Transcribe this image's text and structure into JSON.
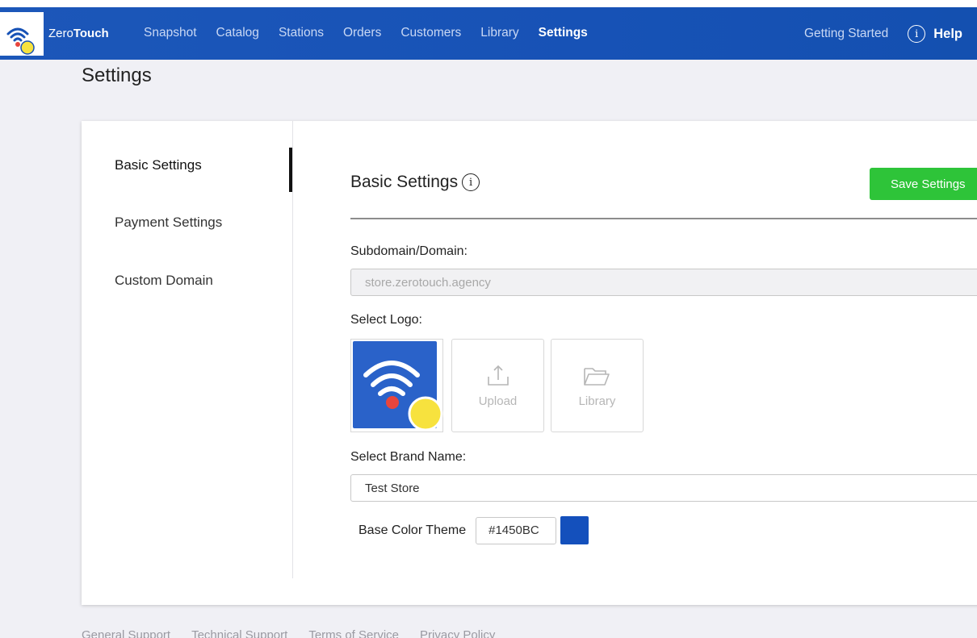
{
  "app": {
    "brand_prefix": "Zero",
    "brand_suffix": "Touch"
  },
  "nav": {
    "items": [
      {
        "label": "Snapshot"
      },
      {
        "label": "Catalog"
      },
      {
        "label": "Stations"
      },
      {
        "label": "Orders"
      },
      {
        "label": "Customers"
      },
      {
        "label": "Library"
      },
      {
        "label": "Settings",
        "active": true
      }
    ],
    "getting_started": "Getting Started",
    "help": "Help"
  },
  "page": {
    "title": "Settings"
  },
  "sidebar": {
    "items": [
      {
        "label": "Basic Settings",
        "active": true
      },
      {
        "label": "Payment Settings"
      },
      {
        "label": "Custom Domain"
      }
    ]
  },
  "basic": {
    "title": "Basic Settings",
    "save_label": "Save Settings",
    "domain_label": "Subdomain/Domain:",
    "domain_value": "store.zerotouch.agency",
    "logo_label": "Select Logo:",
    "upload_label": "Upload",
    "library_label": "Library",
    "brand_label": "Select Brand Name:",
    "brand_value": "Test Store",
    "color_label": "Base Color Theme",
    "color_hex": "#1450BC"
  },
  "colors": {
    "nav_bg": "#1752b6",
    "save_button": "#2ec439",
    "theme_swatch": "#1450bc",
    "logo_bg": "#2a62c9",
    "logo_dot_red": "#e8453c",
    "logo_dot_yellow": "#f7e23e"
  },
  "footer": {
    "links": [
      {
        "label": "General Support"
      },
      {
        "label": "Technical Support"
      },
      {
        "label": "Terms of Service"
      },
      {
        "label": "Privacy Policy"
      }
    ]
  }
}
